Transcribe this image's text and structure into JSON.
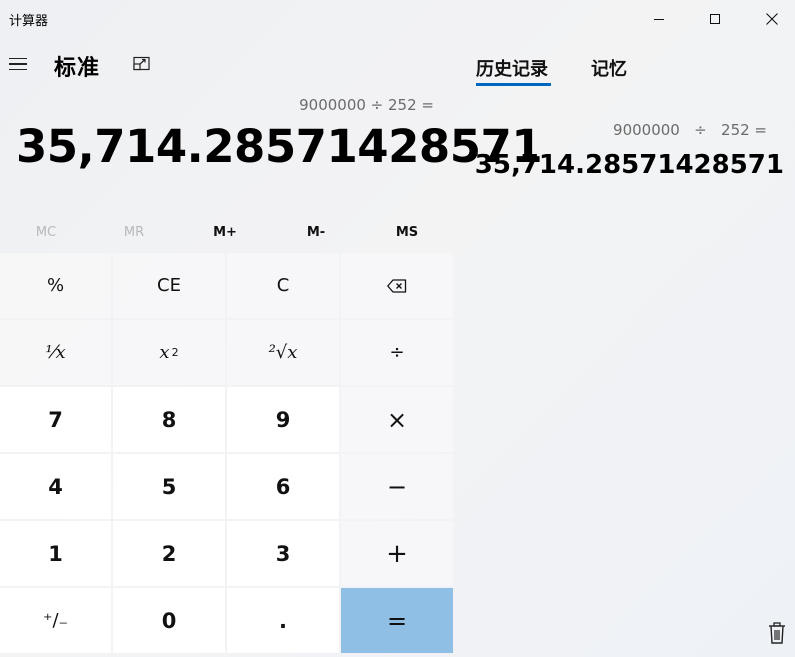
{
  "window": {
    "title": "计算器"
  },
  "header": {
    "mode_title": "标准"
  },
  "display": {
    "expression": "9000000 ÷ 252 =",
    "result": "35,714.28571428571"
  },
  "memory_buttons": [
    {
      "label": "MC",
      "enabled": false
    },
    {
      "label": "MR",
      "enabled": false
    },
    {
      "label": "M+",
      "enabled": true
    },
    {
      "label": "M-",
      "enabled": true
    },
    {
      "label": "MS",
      "enabled": true
    }
  ],
  "keypad": {
    "percent": "%",
    "clear_entry": "CE",
    "clear": "C",
    "reciprocal": "⅟x",
    "square_base": "x",
    "square_exp": "2",
    "sqrt": "²√x",
    "divide": "÷",
    "seven": "7",
    "eight": "8",
    "nine": "9",
    "multiply": "×",
    "four": "4",
    "five": "5",
    "six": "6",
    "subtract": "−",
    "one": "1",
    "two": "2",
    "three": "3",
    "add": "+",
    "negate": "⁺/₋",
    "zero": "0",
    "decimal": ".",
    "equals": "="
  },
  "history_pane": {
    "tabs": [
      {
        "label": "历史记录",
        "active": true
      },
      {
        "label": "记忆",
        "active": false
      }
    ],
    "entries": [
      {
        "expression": "9000000   ÷   252 =",
        "result": "35,714.28571428571"
      }
    ]
  },
  "colors": {
    "accent": "#0067c0",
    "equals_key": "#90bfe6",
    "secondary_text": "#6b6b6b"
  }
}
